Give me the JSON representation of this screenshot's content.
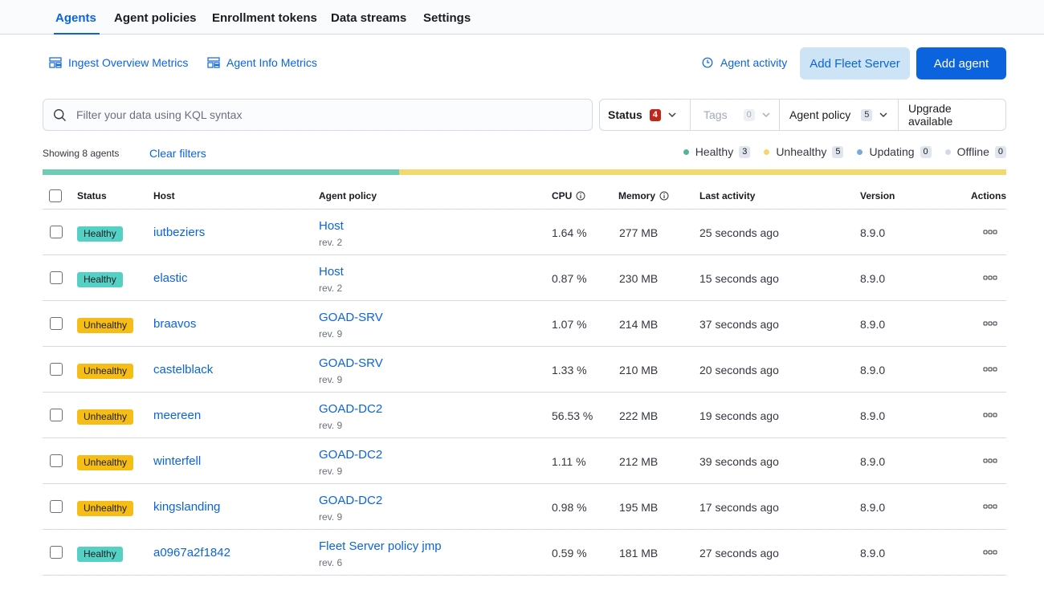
{
  "tabs": [
    {
      "label": "Agents",
      "active": true
    },
    {
      "label": "Agent policies"
    },
    {
      "label": "Enrollment tokens"
    },
    {
      "label": "Data streams"
    },
    {
      "label": "Settings"
    }
  ],
  "header": {
    "ingest_metrics_link": "Ingest Overview Metrics",
    "agent_info_link": "Agent Info Metrics",
    "agent_activity_link": "Agent activity",
    "add_fleet_server_label": "Add Fleet Server",
    "add_agent_label": "Add agent"
  },
  "filters": {
    "search_placeholder": "Filter your data using KQL syntax",
    "status": {
      "label": "Status",
      "count": "4"
    },
    "tags": {
      "label": "Tags",
      "count": "0"
    },
    "agent_policy": {
      "label": "Agent policy",
      "count": "5"
    },
    "upgrade_available": {
      "label": "Upgrade available"
    }
  },
  "summary": {
    "showing": "Showing 8 agents",
    "clear_filters": "Clear filters",
    "legend": [
      {
        "label": "Healthy",
        "count": "3",
        "color": "#54b399"
      },
      {
        "label": "Unhealthy",
        "count": "5",
        "color": "#f1d86f"
      },
      {
        "label": "Updating",
        "count": "0",
        "color": "#79aad9"
      },
      {
        "label": "Offline",
        "count": "0",
        "color": "#d3dae6"
      }
    ],
    "health_fractions": {
      "healthy": 0.37,
      "unhealthy": 0.63
    }
  },
  "table": {
    "columns": {
      "status": "Status",
      "host": "Host",
      "agent_policy": "Agent policy",
      "cpu": "CPU",
      "memory": "Memory",
      "last_activity": "Last activity",
      "version": "Version",
      "actions": "Actions"
    },
    "rows": [
      {
        "status": "Healthy",
        "status_type": "healthy",
        "host": "iutbeziers",
        "policy": "Host",
        "rev": "rev. 2",
        "cpu": "1.64 %",
        "memory": "277 MB",
        "last_activity": "25 seconds ago",
        "version": "8.9.0"
      },
      {
        "status": "Healthy",
        "status_type": "healthy",
        "host": "elastic",
        "policy": "Host",
        "rev": "rev. 2",
        "cpu": "0.87 %",
        "memory": "230 MB",
        "last_activity": "15 seconds ago",
        "version": "8.9.0"
      },
      {
        "status": "Unhealthy",
        "status_type": "unhealthy",
        "host": "braavos",
        "policy": "GOAD-SRV",
        "rev": "rev. 9",
        "cpu": "1.07 %",
        "memory": "214 MB",
        "last_activity": "37 seconds ago",
        "version": "8.9.0"
      },
      {
        "status": "Unhealthy",
        "status_type": "unhealthy",
        "host": "castelblack",
        "policy": "GOAD-SRV",
        "rev": "rev. 9",
        "cpu": "1.33 %",
        "memory": "210 MB",
        "last_activity": "20 seconds ago",
        "version": "8.9.0"
      },
      {
        "status": "Unhealthy",
        "status_type": "unhealthy",
        "host": "meereen",
        "policy": "GOAD-DC2",
        "rev": "rev. 9",
        "cpu": "56.53 %",
        "memory": "222 MB",
        "last_activity": "19 seconds ago",
        "version": "8.9.0"
      },
      {
        "status": "Unhealthy",
        "status_type": "unhealthy",
        "host": "winterfell",
        "policy": "GOAD-DC2",
        "rev": "rev. 9",
        "cpu": "1.11 %",
        "memory": "212 MB",
        "last_activity": "39 seconds ago",
        "version": "8.9.0"
      },
      {
        "status": "Unhealthy",
        "status_type": "unhealthy",
        "host": "kingslanding",
        "policy": "GOAD-DC2",
        "rev": "rev. 9",
        "cpu": "0.98 %",
        "memory": "195 MB",
        "last_activity": "17 seconds ago",
        "version": "8.9.0"
      },
      {
        "status": "Healthy",
        "status_type": "healthy",
        "host": "a0967a2f1842",
        "policy": "Fleet Server policy jmp",
        "rev": "rev. 6",
        "cpu": "0.59 %",
        "memory": "181 MB",
        "last_activity": "27 seconds ago",
        "version": "8.9.0"
      }
    ]
  }
}
